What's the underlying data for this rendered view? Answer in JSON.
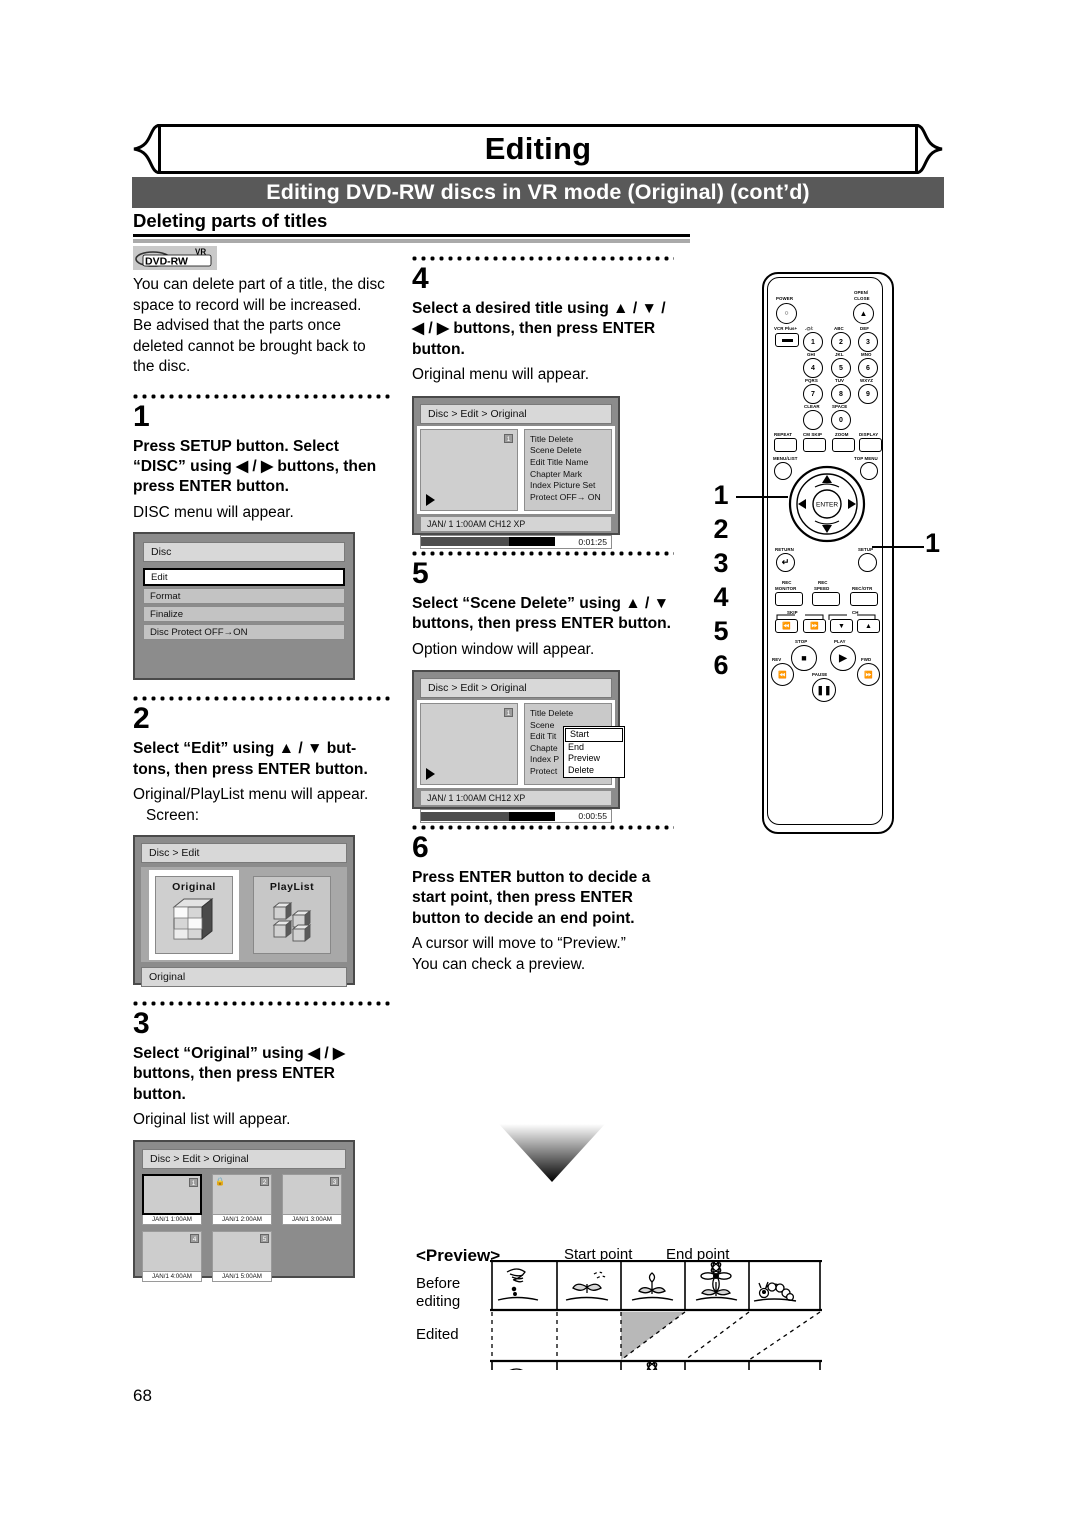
{
  "header": {
    "title": "Editing",
    "subtitle": "Editing DVD-RW discs in VR mode (Original) (cont’d)",
    "section": "Deleting parts of titles"
  },
  "page_number": "68",
  "disc_badge": {
    "top": "VR",
    "main": "DVD-RW"
  },
  "intro": {
    "p1": "You can delete part of a title, the disc space to record will be increased.",
    "p2": "Be advised that the parts once deleted cannot be brought back to the disc."
  },
  "steps": [
    {
      "number": "1",
      "title": "Press SETUP button. Select “DISC” using ◀ / ▶ buttons, then press ENTER button.",
      "note": "DISC menu will appear."
    },
    {
      "number": "2",
      "title": "Select “Edit” using ▲ / ▼ but-tons, then press ENTER button.",
      "note": "Original/PlayList menu will appear.",
      "note2": "Screen:"
    },
    {
      "number": "3",
      "title": "Select “Original” using ◀ / ▶ buttons, then press ENTER button.",
      "note": "Original list will appear."
    },
    {
      "number": "4",
      "title": "Select a desired title using ▲ / ▼ / ◀ / ▶ buttons, then press ENTER button.",
      "note": "Original menu will appear."
    },
    {
      "number": "5",
      "title": "Select “Scene Delete” using ▲ / ▼ buttons, then press ENTER button.",
      "note": "Option window will appear."
    },
    {
      "number": "6",
      "title": "Press ENTER button to decide a start point, then press ENTER button to decide an end point.",
      "note": "A cursor will move to “Preview.”",
      "note2": "You can check a preview."
    }
  ],
  "osd_disc_menu": {
    "title": "Disc",
    "items": [
      {
        "label": "Edit",
        "selected": true
      },
      {
        "label": "Format",
        "selected": false
      },
      {
        "label": "Finalize",
        "selected": false
      },
      {
        "label": "Disc Protect OFF→ON",
        "selected": false
      }
    ]
  },
  "osd_edit_menu": {
    "breadcrumb": "Disc > Edit",
    "tiles": [
      {
        "label": "Original",
        "selected": true
      },
      {
        "label": "PlayList",
        "selected": false
      }
    ],
    "status": "Original"
  },
  "osd_original_list": {
    "breadcrumb": "Disc > Edit > Original",
    "thumbs": [
      {
        "num": "1",
        "caption": "JAN/1  1:00AM",
        "selected": true,
        "locked": false
      },
      {
        "num": "2",
        "caption": "JAN/1  2:00AM",
        "selected": false,
        "locked": true
      },
      {
        "num": "3",
        "caption": "JAN/1  3:00AM",
        "selected": false,
        "locked": false
      },
      {
        "num": "4",
        "caption": "JAN/1  4:00AM",
        "selected": false,
        "locked": false
      },
      {
        "num": "5",
        "caption": "JAN/1  5:00AM",
        "selected": false,
        "locked": false
      }
    ]
  },
  "osd_title_menu": {
    "breadcrumb": "Disc > Edit > Original",
    "thumb_num": "1",
    "menu": [
      {
        "label": "Title Delete",
        "selected": true
      },
      {
        "label": "Scene Delete",
        "selected": false
      },
      {
        "label": "Edit Title Name",
        "selected": false
      },
      {
        "label": "Chapter Mark",
        "selected": false
      },
      {
        "label": "Index Picture Set",
        "selected": false
      },
      {
        "label": "Protect OFF→ ON",
        "selected": false
      }
    ],
    "info": "JAN/ 1  1:00AM  CH12      XP",
    "time": "0:01:25"
  },
  "osd_scene_delete": {
    "breadcrumb": "Disc > Edit > Original",
    "thumb_num": "1",
    "menu": [
      {
        "label": "Title Delete"
      },
      {
        "label": "Scene"
      },
      {
        "label": "Edit Tit"
      },
      {
        "label": "Chapte"
      },
      {
        "label": "Index P"
      },
      {
        "label": "Protect"
      }
    ],
    "popup": [
      {
        "label": "Start",
        "selected": true
      },
      {
        "label": "End",
        "selected": false
      },
      {
        "label": "Preview",
        "selected": false
      },
      {
        "label": "Delete",
        "selected": false
      }
    ],
    "info": "JAN/ 1  1:00AM  CH12      XP",
    "time": "0:00:55"
  },
  "preview_diagram": {
    "label": "<Preview>",
    "start_point": "Start point",
    "end_point": "End point",
    "row1_label_line1": "Before",
    "row1_label_line2": "editing",
    "row2_label": "Edited"
  },
  "remote": {
    "labels": {
      "power": "POWER",
      "open_close_l1": "OPEN/",
      "open_close_l2": "CLOSE",
      "vcr_plus": "VCR Plus+",
      "k1_alpha": ".@/:",
      "k2_alpha": "ABC",
      "k3_alpha": "DEF",
      "k4_alpha": "GHI",
      "k5_alpha": "JKL",
      "k6_alpha": "MNO",
      "k7_alpha": "PQRS",
      "k8_alpha": "TUV",
      "k9_alpha": "WXYZ",
      "clear": "CLEAR",
      "space": "SPACE",
      "repeat": "REPEAT",
      "cm_skip": "CM SKIP",
      "zoom": "ZOOM",
      "display": "DISPLAY",
      "menu_list": "MENU/LIST",
      "top_menu": "TOP MENU",
      "enter": "ENTER",
      "return": "RETURN",
      "setup": "SETUP",
      "rec_monitor_l1": "REC",
      "rec_monitor_l2": "MONITOR",
      "rec_speed_l1": "REC",
      "rec_speed_l2": "SPEED",
      "rec_otr": "REC/OTR",
      "skip": "SKIP",
      "ch": "CH",
      "stop": "STOP",
      "play": "PLAY",
      "rev": "REV",
      "fwd": "FWD",
      "pause": "PAUSE"
    },
    "keys": [
      "1",
      "2",
      "3",
      "4",
      "5",
      "6",
      "7",
      "8",
      "9",
      "0"
    ],
    "callout_left": [
      "1",
      "2",
      "3",
      "4",
      "5",
      "6"
    ],
    "callout_right": "1"
  }
}
